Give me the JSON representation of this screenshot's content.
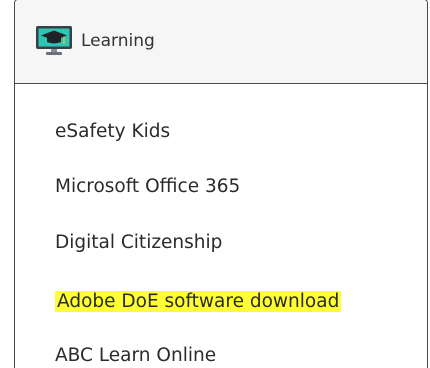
{
  "panel": {
    "title": "Learning",
    "icon": "graduation-monitor-icon"
  },
  "links": [
    {
      "label": "eSafety Kids",
      "highlighted": false
    },
    {
      "label": "Microsoft Office 365",
      "highlighted": false
    },
    {
      "label": "Digital Citizenship",
      "highlighted": false
    },
    {
      "label": "Adobe DoE software download",
      "highlighted": true,
      "highlight_color": "#ffff33"
    },
    {
      "label": "ABC Learn Online",
      "highlighted": false
    }
  ]
}
